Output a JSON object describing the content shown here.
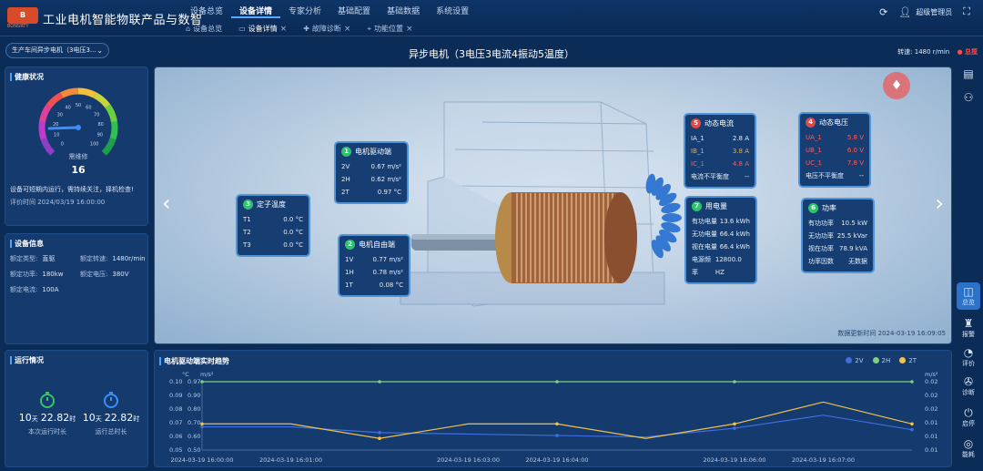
{
  "app": {
    "logo_text": "B",
    "logo_sub": "BONSRTY",
    "title": "工业电机智能物联产品与数智"
  },
  "nav": {
    "items": [
      "设备总览",
      "设备详情",
      "专家分析",
      "基础配置",
      "基础数据",
      "系统设置"
    ],
    "active": 1
  },
  "tabs": [
    {
      "label": "设备总览",
      "icon": "home-icon",
      "closable": false
    },
    {
      "label": "设备详情",
      "icon": "monitor-icon",
      "closable": true
    },
    {
      "label": "故障诊断",
      "icon": "stethoscope-icon",
      "closable": true
    },
    {
      "label": "功能位置",
      "icon": "pin-icon",
      "closable": true
    }
  ],
  "user": {
    "name": "超级管理员"
  },
  "device_select": {
    "value": "生产车间异步电机（3电压3..."
  },
  "page_title": "异步电机（3电压3电流4振动5温度）",
  "speed": {
    "label": "转速: 1480 r/min",
    "status": "总揽"
  },
  "health": {
    "title": "健康状况",
    "gauge_value": 16,
    "gauge_max": 100,
    "gauge_label": "需维修",
    "ticks": [
      "0",
      "10",
      "20",
      "30",
      "40",
      "50",
      "60",
      "70",
      "80",
      "90",
      "100"
    ],
    "message": "设备可短期内运行，需持续关注，择机检查!",
    "eval_time": "评价时间   2024/03/19 16:00:00"
  },
  "device_info": {
    "title": "设备信息",
    "rows": [
      [
        "额定类型:",
        "直驱",
        "额定转速:",
        "1480r/min"
      ],
      [
        "额定功率:",
        "180kw",
        "额定电压:",
        "380V"
      ],
      [
        "额定电流:",
        "100A",
        "",
        ""
      ]
    ]
  },
  "run": {
    "title": "运行情况",
    "items": [
      {
        "days": "10",
        "hours": "22.82",
        "label": "本次运行时长"
      },
      {
        "days": "10",
        "hours": "22.82",
        "label": "运行总时长"
      }
    ],
    "day_unit": "天",
    "hour_unit": "时"
  },
  "cards": {
    "drive_end": {
      "num": "1",
      "title": "电机驱动端",
      "rows": [
        [
          "2V",
          "0.67 m/s²"
        ],
        [
          "2H",
          "0.62 m/s²"
        ],
        [
          "2T",
          "0.97 °C"
        ]
      ]
    },
    "free_end": {
      "num": "2",
      "title": "电机自由端",
      "rows": [
        [
          "1V",
          "0.77 m/s²"
        ],
        [
          "1H",
          "0.78 m/s²"
        ],
        [
          "1T",
          "0.08 °C"
        ]
      ]
    },
    "stator": {
      "num": "3",
      "title": "定子温度",
      "rows": [
        [
          "T1",
          "0.0 °C"
        ],
        [
          "T2",
          "0.0 °C"
        ],
        [
          "T3",
          "0.0 °C"
        ]
      ]
    },
    "voltage": {
      "num": "4",
      "title": "动态电压",
      "rows": [
        [
          "UA_1",
          "5.8 V"
        ],
        [
          "UB_1",
          "6.0 V"
        ],
        [
          "UC_1",
          "7.8 V"
        ],
        [
          "电压不平衡度",
          "--"
        ]
      ]
    },
    "current": {
      "num": "5",
      "title": "动态电流",
      "rows": [
        [
          "IA_1",
          "2.8 A"
        ],
        [
          "IB_1",
          "3.8 A"
        ],
        [
          "IC_1",
          "4.8 A"
        ],
        [
          "电流不平衡度",
          "--"
        ]
      ]
    },
    "power": {
      "num": "6",
      "title": "功率",
      "rows": [
        [
          "有功功率",
          "10.5 kW"
        ],
        [
          "无功功率",
          "25.5 kVar"
        ],
        [
          "视在功率",
          "78.9 kVA"
        ],
        [
          "功率因数",
          "无数据"
        ]
      ]
    },
    "energy": {
      "num": "7",
      "title": "用电量",
      "rows": [
        [
          "有功电量",
          "13.6 kWh"
        ],
        [
          "无功电量",
          "66.4 kWh"
        ],
        [
          "视在电量",
          "66.4 kWh"
        ],
        [
          "电源频率",
          "12800.0 HZ"
        ]
      ]
    }
  },
  "data_update": "数据更新时间   2024-03-19 16:09:05",
  "trend": {
    "title": "电机驱动端实时趋势",
    "unit_left_a": "°C",
    "unit_left_b": "m/s²",
    "unit_right": "m/s²",
    "legend": [
      {
        "name": "2V",
        "color": "#3f6fe0"
      },
      {
        "name": "2H",
        "color": "#7fd07a"
      },
      {
        "name": "2T",
        "color": "#f2c14e"
      }
    ]
  },
  "chart_data": {
    "type": "line",
    "title": "电机驱动端实时趋势",
    "x": [
      "2024-03-19 16:00:00",
      "2024-03-19 16:01:00",
      "2024-03-19 16:02:00",
      "2024-03-19 16:03:00",
      "2024-03-19 16:04:00",
      "2024-03-19 16:05:00",
      "2024-03-19 16:06:00",
      "2024-03-19 16:07:00",
      "2024-03-19 16:08:00"
    ],
    "x_ticks": [
      "2024-03-19 16:00:00",
      "2024-03-19 16:01:00",
      "2024-03-19 16:03:00",
      "2024-03-19 16:04:00",
      "2024-03-19 16:06:00",
      "2024-03-19 16:07:00"
    ],
    "y_left_temp_ticks": [
      "0.05",
      "0.06",
      "0.07",
      "0.08",
      "0.09",
      "0.10"
    ],
    "y_left_vib_ticks": [
      "0.50",
      "0.60",
      "0.70",
      "0.80",
      "0.90",
      "0.97"
    ],
    "y_right_ticks": [
      "0.01",
      "0.01",
      "0.01",
      "0.02",
      "0.02",
      "0.02"
    ],
    "ylim": [
      0.5,
      0.97
    ],
    "series": [
      {
        "name": "2V",
        "color": "#3f6fe0",
        "values": [
          0.66,
          0.66,
          0.62,
          0.61,
          0.6,
          0.59,
          0.65,
          0.74,
          0.64
        ]
      },
      {
        "name": "2H",
        "color": "#7fd07a",
        "values": [
          0.97,
          0.97,
          0.97,
          0.97,
          0.97,
          0.97,
          0.97,
          0.97,
          0.97
        ]
      },
      {
        "name": "2T",
        "color": "#f2c14e",
        "values": [
          0.68,
          0.68,
          0.58,
          0.68,
          0.68,
          0.58,
          0.68,
          0.83,
          0.68
        ]
      }
    ]
  },
  "rail": [
    {
      "icon": "panel-icon",
      "label": ""
    },
    {
      "icon": "users-icon",
      "label": ""
    },
    {
      "icon": "overview-icon",
      "label": "总览"
    },
    {
      "icon": "alarm-icon",
      "label": "报警"
    },
    {
      "icon": "evaluate-icon",
      "label": "评价"
    },
    {
      "icon": "diagnose-icon",
      "label": "诊断"
    },
    {
      "icon": "start-stop-icon",
      "label": "启停"
    },
    {
      "icon": "energy-icon",
      "label": "能耗"
    }
  ]
}
